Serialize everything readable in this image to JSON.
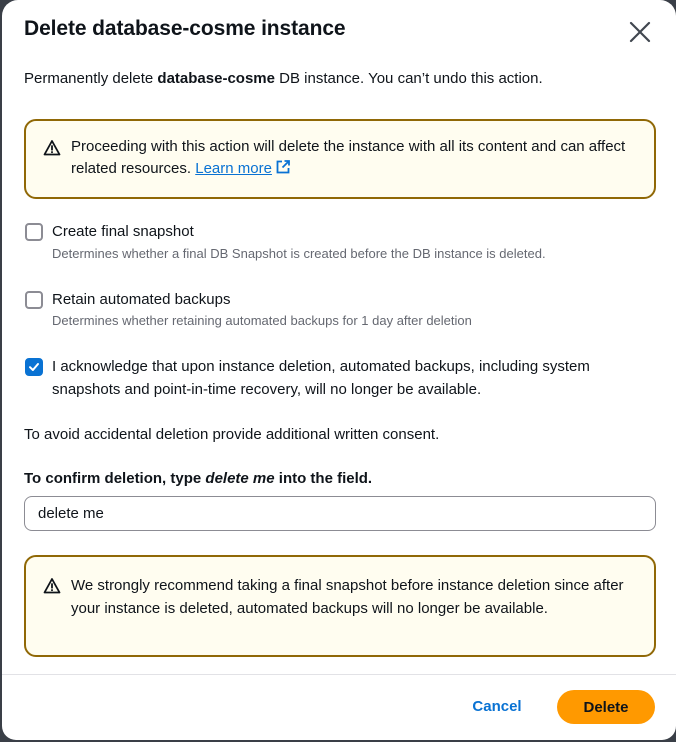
{
  "modal": {
    "title": "Delete database-cosme instance",
    "intro_prefix": "Permanently delete ",
    "intro_instance": "database-cosme",
    "intro_suffix": " DB instance. You can’t undo this action."
  },
  "warning_alert": {
    "text": "Proceeding with this action will delete the instance with all its content and can affect related resources. ",
    "link_label": "Learn more",
    "icon": "warning-icon",
    "link_icon": "external-link-icon"
  },
  "options": [
    {
      "label": "Create final snapshot",
      "description": "Determines whether a final DB Snapshot is created before the DB instance is deleted.",
      "checked": false
    },
    {
      "label": "Retain automated backups",
      "description": "Determines whether retaining automated backups for 1 day after deletion",
      "checked": false
    },
    {
      "label": "I acknowledge that upon instance deletion, automated backups, including system snapshots and point-in-time recovery, will no longer be available.",
      "checked": true
    }
  ],
  "consent_note": "To avoid accidental deletion provide additional written consent.",
  "confirm": {
    "label_prefix": "To confirm deletion, type ",
    "label_phrase": "delete me",
    "label_suffix": " into the field.",
    "value": "delete me"
  },
  "snapshot_alert": {
    "text": "We strongly recommend taking a final snapshot before instance deletion since after your instance is deleted, automated backups will no longer be available.",
    "icon": "warning-icon"
  },
  "footer": {
    "cancel_label": "Cancel",
    "delete_label": "Delete"
  },
  "colors": {
    "accent": "#0972d3",
    "primary_button": "#ff9900",
    "warning_border": "#906806",
    "warning_background": "#fffdf0"
  }
}
